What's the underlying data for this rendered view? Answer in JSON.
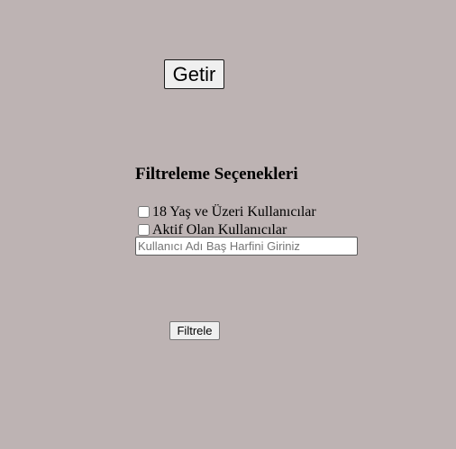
{
  "fetch": {
    "button_label": "Getir"
  },
  "filters": {
    "title": "Filtreleme Seçenekleri",
    "options": [
      {
        "label": "18 Yaş ve Üzeri Kullanıcılar",
        "checked": false
      },
      {
        "label": "Aktif Olan Kullanıcılar",
        "checked": false
      }
    ],
    "name_input": {
      "value": "",
      "placeholder": "Kullanıcı Adı Baş Harfini Giriniz"
    },
    "submit_label": "Filtrele"
  },
  "colors": {
    "background": "#bdb3b3",
    "button_face": "#efefef"
  }
}
